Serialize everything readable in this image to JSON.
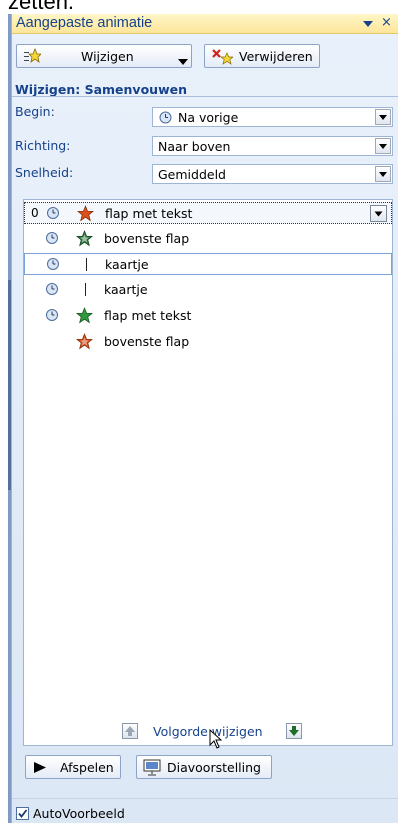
{
  "outside_text": "zetten.",
  "pane": {
    "title": "Aangepaste animatie",
    "close_glyph": "×"
  },
  "toolbar": {
    "change_label": "Wijzigen",
    "remove_label": "Verwijderen"
  },
  "section": {
    "heading": "Wijzigen: Samenvouwen"
  },
  "properties": [
    {
      "label": "Begin:",
      "value": "Na vorige",
      "has_clock": true
    },
    {
      "label": "Richting:",
      "value": "Naar boven",
      "has_clock": false
    },
    {
      "label": "Snelheid:",
      "value": "Gemiddeld",
      "has_clock": false
    }
  ],
  "animations": [
    {
      "number": "0",
      "clock": true,
      "icon": "star-exit-icon",
      "icon_color": "#d9501e",
      "label": "flap met tekst",
      "state": "selected"
    },
    {
      "number": "",
      "clock": true,
      "icon": "star-emphasis-icon",
      "icon_color": "#2e7a3c",
      "label": "bovenste flap",
      "state": ""
    },
    {
      "number": "",
      "clock": true,
      "icon": "bar-icon",
      "icon_color": "#222222",
      "label": "kaartje",
      "state": "focused"
    },
    {
      "number": "",
      "clock": true,
      "icon": "bar-icon",
      "icon_color": "#222222",
      "label": "kaartje",
      "state": ""
    },
    {
      "number": "",
      "clock": true,
      "icon": "star-entrance-icon",
      "icon_color": "#2e9a3c",
      "label": "flap met tekst",
      "state": ""
    },
    {
      "number": "",
      "clock": false,
      "icon": "star-exit-icon",
      "icon_color": "#d9501e",
      "label": "bovenste flap",
      "state": ""
    }
  ],
  "reorder": {
    "label": "Volgorde wijzigen"
  },
  "playback": {
    "play_label": "Afspelen",
    "slideshow_label": "Diavoorstelling"
  },
  "autopreview": {
    "label": "AutoVoorbeeld",
    "checked": true
  },
  "colors": {
    "heading_blue": "#15428b",
    "title_gold": "#fde69a",
    "pane_blue": "#dce7f5"
  }
}
